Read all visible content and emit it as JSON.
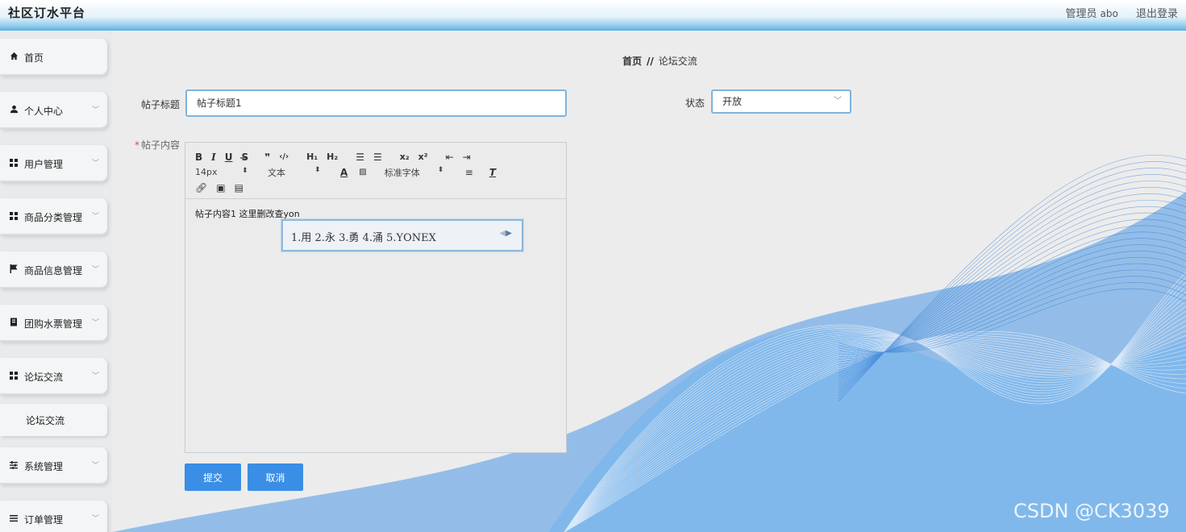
{
  "app": {
    "title": "社区订水平台"
  },
  "topbar": {
    "role": "管理员",
    "username": "abo",
    "logout": "退出登录"
  },
  "sidebar": {
    "items": [
      {
        "label": "首页",
        "icon": "home-icon"
      },
      {
        "label": "个人中心",
        "icon": "user-icon"
      },
      {
        "label": "用户管理",
        "icon": "grid-icon"
      },
      {
        "label": "商品分类管理",
        "icon": "grid-icon"
      },
      {
        "label": "商品信息管理",
        "icon": "flag-icon"
      },
      {
        "label": "团购水票管理",
        "icon": "book-icon"
      },
      {
        "label": "论坛交流",
        "icon": "grid-icon"
      },
      {
        "label": "系统管理",
        "icon": "sliders-icon"
      },
      {
        "label": "订单管理",
        "icon": "list-icon"
      }
    ],
    "sub_item": "论坛交流"
  },
  "breadcrumb": {
    "home": "首页",
    "separator": "//",
    "current": "论坛交流"
  },
  "form": {
    "title_label": "帖子标题",
    "title_value": "帖子标题1",
    "status_label": "状态",
    "status_value": "开放",
    "content_label": "帖子内容",
    "content_value": "帖子内容1 这里删改查yon",
    "submit": "提交",
    "cancel": "取消"
  },
  "editor_toolbar": {
    "font_size": "14px",
    "header": "文本",
    "font_family": "标准字体"
  },
  "ime": {
    "candidates": "1.用  2.永  3.勇  4.涌  5.YONEX"
  },
  "watermark": "CSDN @CK3039",
  "colors": {
    "accent": "#3a8ee6",
    "header_blue": "#5ab0e0",
    "focus_border": "#7fb3dc"
  }
}
